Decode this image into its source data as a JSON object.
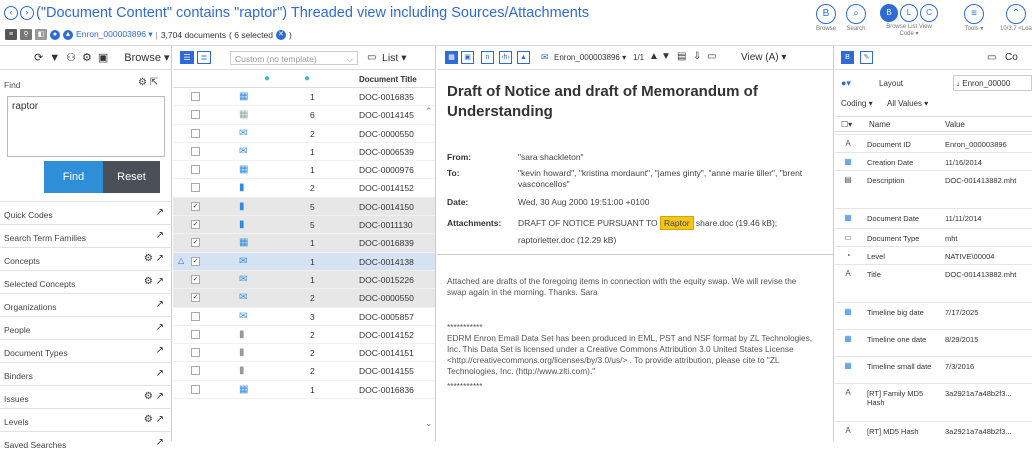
{
  "header": {
    "title": "(\"Document Content\" contains \"raptor\") Threaded view including Sources/Attachments",
    "workspace": "Enron_000003896 ▾",
    "doc_count": "3,704 documents",
    "selected": "( 6 selected",
    "toolbar": [
      {
        "label": "Browse",
        "icon": "B"
      },
      {
        "label": "Search",
        "icon": "⌕"
      },
      {
        "label": "Browse List View Code ▾",
        "icon": "☷"
      },
      {
        "label": "",
        "icon": "≡"
      },
      {
        "label": "Tools ▾",
        "icon": "⚙"
      },
      {
        "label": "10/3.7 <Loa",
        "icon": "▲"
      }
    ]
  },
  "left": {
    "browse_label": "Browse ▾",
    "find_label": "Find",
    "find_value": "raptor",
    "find_button": "Find",
    "reset_button": "Reset",
    "sections": [
      {
        "label": "Quick Codes",
        "gear": false
      },
      {
        "label": "Search Term Families",
        "gear": false
      },
      {
        "label": "Concepts",
        "gear": true
      },
      {
        "label": "Selected Concepts",
        "gear": true
      },
      {
        "label": "Organizations",
        "gear": false
      },
      {
        "label": "People",
        "gear": false
      },
      {
        "label": "Document Types",
        "gear": false
      },
      {
        "label": "Binders",
        "gear": false
      },
      {
        "label": "Issues",
        "gear": true
      },
      {
        "label": "Levels",
        "gear": true
      },
      {
        "label": "Saved Searches",
        "gear": false
      }
    ]
  },
  "list": {
    "template": "Custom (no template)",
    "view": "List ▾",
    "col_doc": "Document Title",
    "rows": [
      {
        "icon": "table",
        "num": "1",
        "doc": "DOC-0016835",
        "checked": false,
        "state": ""
      },
      {
        "icon": "grid",
        "num": "6",
        "doc": "DOC-0014145",
        "checked": false,
        "state": ""
      },
      {
        "icon": "mail",
        "num": "2",
        "doc": "DOC-0000550",
        "checked": false,
        "state": ""
      },
      {
        "icon": "mail",
        "num": "1",
        "doc": "DOC-0006539",
        "checked": false,
        "state": ""
      },
      {
        "icon": "table",
        "num": "1",
        "doc": "DOC-0000976",
        "checked": false,
        "state": ""
      },
      {
        "icon": "page",
        "num": "2",
        "doc": "DOC-0014152",
        "checked": false,
        "state": ""
      },
      {
        "icon": "page",
        "num": "5",
        "doc": "DOC-0014150",
        "checked": true,
        "state": "hl"
      },
      {
        "icon": "page",
        "num": "5",
        "doc": "DOC-0011130",
        "checked": true,
        "state": "hl"
      },
      {
        "icon": "table",
        "num": "1",
        "doc": "DOC-0016839",
        "checked": true,
        "state": "hl"
      },
      {
        "icon": "mail",
        "num": "1",
        "doc": "DOC-0014138",
        "checked": true,
        "state": "sel2"
      },
      {
        "icon": "mail",
        "num": "1",
        "doc": "DOC-0015226",
        "checked": true,
        "state": "hl"
      },
      {
        "icon": "mail",
        "num": "2",
        "doc": "DOC-0000550",
        "checked": true,
        "state": "hl"
      },
      {
        "icon": "mail",
        "num": "3",
        "doc": "DOC-0005857",
        "checked": false,
        "state": ""
      },
      {
        "icon": "grey",
        "num": "2",
        "doc": "DOC-0014152",
        "checked": false,
        "state": ""
      },
      {
        "icon": "grey",
        "num": "2",
        "doc": "DOC-0014151",
        "checked": false,
        "state": ""
      },
      {
        "icon": "grey",
        "num": "2",
        "doc": "DOC-0014155",
        "checked": false,
        "state": ""
      },
      {
        "icon": "table",
        "num": "1",
        "doc": "DOC-0016836",
        "checked": false,
        "state": ""
      }
    ]
  },
  "doc": {
    "doc_id": "Enron_000003896 ▾",
    "pages": "1/1",
    "view": "View (A) ▾",
    "title": "Draft of Notice and draft of Memorandum of Understanding",
    "from_label": "From:",
    "from": "\"sara shackleton\"",
    "to_label": "To:",
    "to": "\"kevin howard\", \"kristina mordaunt\", \"james ginty\", \"anne marie tiller\", \"brent vasconcellos\"",
    "date_label": "Date:",
    "date": "Wed, 30 Aug 2000 19:51:00 +0100",
    "att_label": "Attachments:",
    "att_pre": "DRAFT OF NOTICE PURSUANT TO",
    "att_hit": "Raptor",
    "att_post": "share.doc (19.46 kB);",
    "att_line2": "raptorletter.doc (12.29 kB)",
    "body": "Attached are drafts of the foregoing items in connection with the equity swap.  We will revise the swap again in the morning.  Thanks.  Sara",
    "stars": "***********",
    "footer": "EDRM Enron Email Data Set has been produced in EML, PST and NSF format by ZL Technologies, Inc. This Data Set is licensed under a Creative Commons Attribution 3.0 United States License <http://creativecommons.org/licenses/by/3.0/us/> . To provide attribution, please cite to \"ZL Technologies, Inc. (http://www.zlti.com).\"",
    "stars2": "***********"
  },
  "coding": {
    "layout": "Layout",
    "doc": "Enron_00000",
    "coding_label": "Coding ▾",
    "values_label": "All Values ▾",
    "col_name": "Name",
    "col_value": "Value",
    "co_label": "Co",
    "rows": [
      {
        "icon": "A",
        "name": "Document ID",
        "value": "Enron_000003896"
      },
      {
        "icon": "▦",
        "name": "Creation Date",
        "value": "11/16/2014"
      },
      {
        "icon": "▤",
        "name": "Description",
        "value": "DOC-001413882.mht"
      },
      {
        "icon": "▦",
        "name": "Document Date",
        "value": "11/11/2014"
      },
      {
        "icon": "▭",
        "name": "Document Type",
        "value": "mht"
      },
      {
        "icon": "◔",
        "name": "Level",
        "value": "NATIVE\\00004"
      },
      {
        "icon": "A",
        "name": "Title",
        "value": "DOC-001413882.mht"
      },
      {
        "icon": "▦",
        "name": "Timeline big date",
        "value": "7/17/2025"
      },
      {
        "icon": "▦",
        "name": "Timeline one date",
        "value": "8/29/2015"
      },
      {
        "icon": "▦",
        "name": "Timeline small date",
        "value": "7/3/2016"
      },
      {
        "icon": "A",
        "name": "[RT] Family MD5 Hash",
        "value": "3a2921a7a48b2f3..."
      },
      {
        "icon": "A",
        "name": "[RT] MD5 Hash",
        "value": "3a2921a7a48b2f3..."
      }
    ]
  }
}
